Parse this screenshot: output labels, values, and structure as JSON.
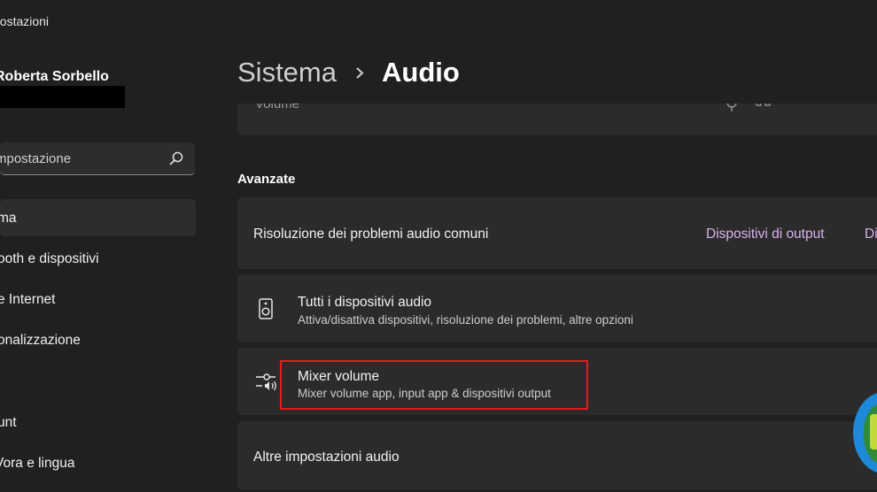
{
  "window": {
    "title": "postazioni"
  },
  "profile": {
    "name": "Roberta Sorbello"
  },
  "search": {
    "placeholder": "Trova un'impostazione",
    "shown_text": "mpostazione"
  },
  "sidebar": {
    "items": [
      {
        "label": "ma",
        "active": true
      },
      {
        "label": "ooth e dispositivi",
        "active": false
      },
      {
        "label": "e Internet",
        "active": false
      },
      {
        "label": "onalizzazione",
        "active": false
      },
      {
        "label": "unt",
        "active": false
      },
      {
        "label": "Vora e lingua",
        "active": false
      }
    ]
  },
  "breadcrumb": {
    "parent": "Sistema",
    "current": "Audio"
  },
  "partial_row": {
    "label": "Volume"
  },
  "advanced": {
    "heading": "Avanzate",
    "troubleshoot": {
      "title": "Risoluzione dei problemi audio comuni",
      "link_output": "Dispositivi di output",
      "link_input_partial": "Di"
    },
    "all_devices": {
      "icon": "speaker-icon",
      "title": "Tutti i dispositivi audio",
      "subtitle": "Attiva/disattiva dispositivi, risoluzione dei problemi, altre opzioni"
    },
    "mixer": {
      "icon": "mixer-icon",
      "title": "Mixer volume",
      "subtitle": "Mixer volume app, input app & dispositivi output"
    },
    "more_settings": {
      "title": "Altre impostazioni audio"
    }
  },
  "colors": {
    "background": "#202020",
    "card": "#2b2b2b",
    "link": "#d7b2ec",
    "highlight": "#e01c1c"
  }
}
